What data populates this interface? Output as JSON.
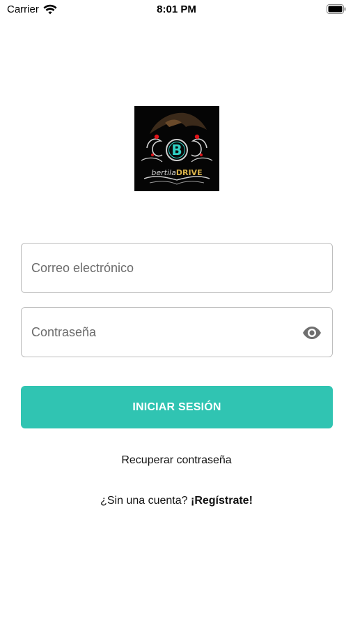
{
  "status_bar": {
    "carrier": "Carrier",
    "time": "8:01 PM"
  },
  "logo": {
    "letter": "B",
    "name_part1": "bertila",
    "name_part2": "DRIVE",
    "colors": {
      "teal": "#2fd1c5",
      "gold": "#d8b24a",
      "red": "#e0151b",
      "silver": "#cfcfcf"
    }
  },
  "login_form": {
    "email_placeholder": "Correo electrónico",
    "password_placeholder": "Contraseña",
    "submit_label": "INICIAR SESIÓN",
    "recover_label": "Recuperar contraseña",
    "signup_prompt": "¿Sin una cuenta?",
    "signup_link": "¡Regístrate!"
  },
  "colors": {
    "accent": "#30c4b2",
    "input_border": "#bdbdbd",
    "placeholder": "#6b6b6b"
  }
}
